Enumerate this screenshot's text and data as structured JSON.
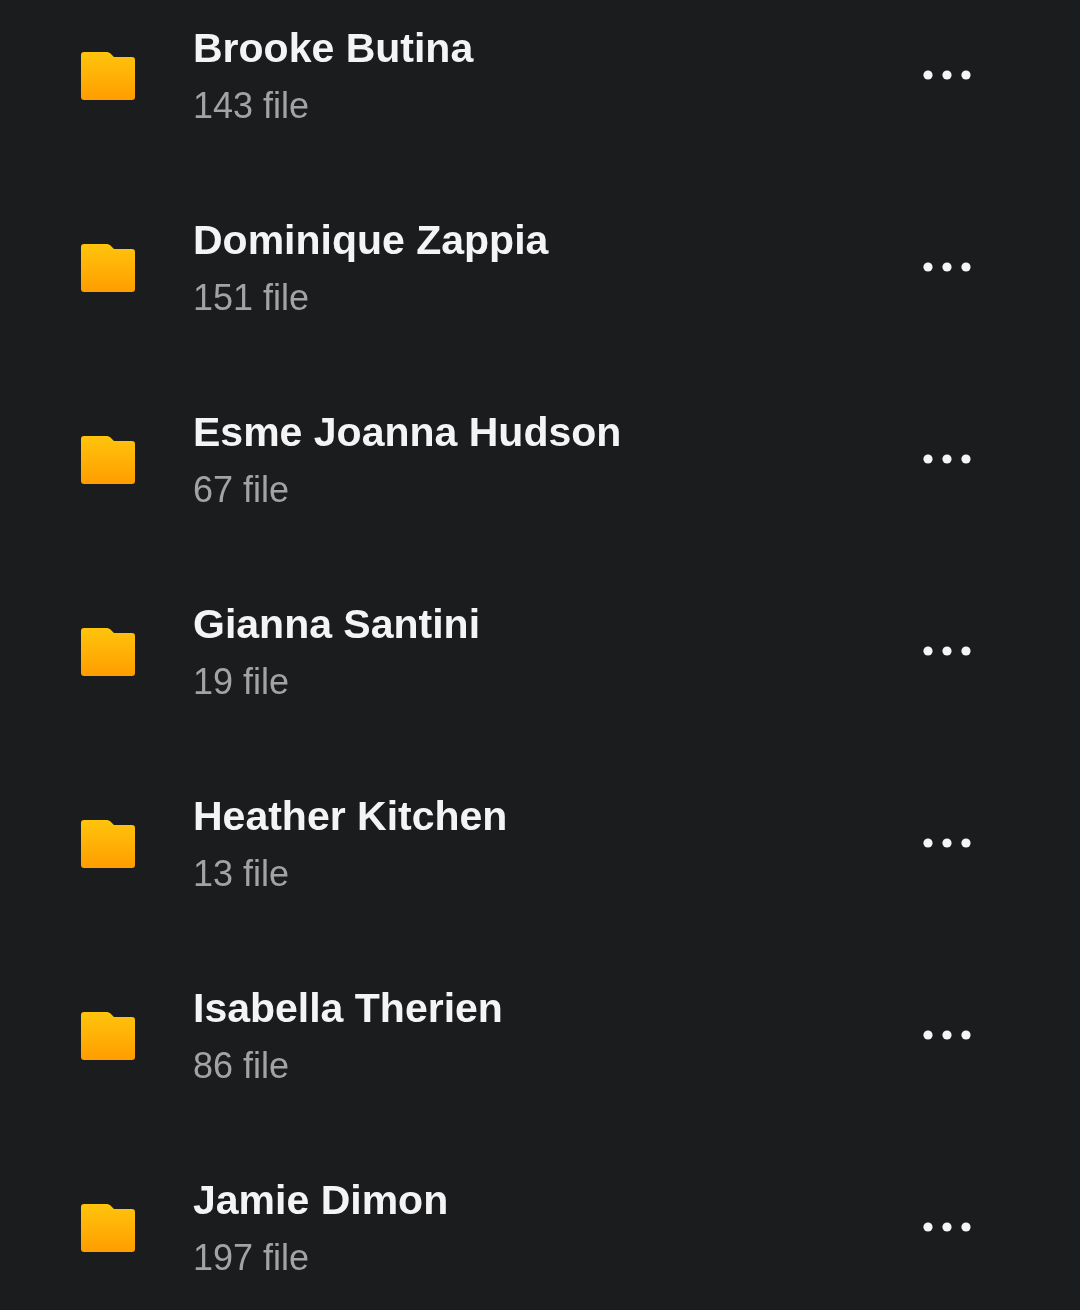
{
  "folders": [
    {
      "name": "Brooke Butina",
      "count": "143 file"
    },
    {
      "name": "Dominique Zappia",
      "count": "151 file"
    },
    {
      "name": "Esme Joanna Hudson",
      "count": "67 file"
    },
    {
      "name": "Gianna Santini",
      "count": "19 file"
    },
    {
      "name": "Heather Kitchen",
      "count": "13 file"
    },
    {
      "name": "Isabella Therien",
      "count": "86 file"
    },
    {
      "name": "Jamie Dimon",
      "count": "197 file"
    }
  ]
}
